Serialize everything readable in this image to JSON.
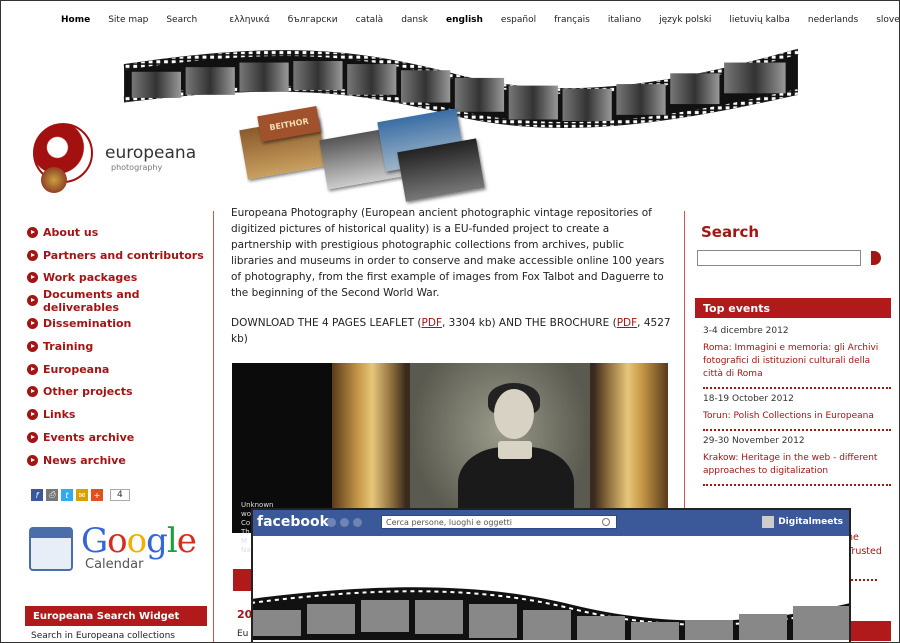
{
  "top_nav": {
    "items": [
      "Home",
      "Site map",
      "Search"
    ],
    "languages": [
      "ελληνικά",
      "български",
      "català",
      "dansk",
      "english",
      "español",
      "français",
      "italiano",
      "język polski",
      "lietuvių kalba",
      "nederlands",
      "slovenčina"
    ],
    "active_language": "english"
  },
  "logo": {
    "name": "europeana",
    "sub": "photography"
  },
  "banner_sign": "BEITHOR",
  "left_nav": [
    "About us",
    "Partners and contributors",
    "Work packages",
    "Documents and deliverables",
    "Dissemination",
    "Training",
    "Europeana",
    "Other projects",
    "Links",
    "Events archive",
    "News archive"
  ],
  "share": {
    "count": "4"
  },
  "google_calendar": {
    "google": "Google",
    "calendar": "Calendar"
  },
  "widget": {
    "title": "Europeana Search Widget",
    "sub": "Search in Europeana collections"
  },
  "main": {
    "intro": "Europeana Photography (European ancient photographic vintage repositories of digitized pictures of historical quality) is a EU-funded project to create a partnership with prestigious photographic collections from archives, public libraries and museums in order to conserve and make accessible online 100 years of photography, from the first example of images from Fox Talbot and Daguerre to the beginning of the Second World War.",
    "download_prefix": "DOWNLOAD THE 4 PAGES LEAFLET (",
    "pdf1": "PDF",
    "download_mid": ", 3304 kb) AND THE BROCHURE (",
    "pdf2": "PDF",
    "download_suffix": ", 4527 kb)",
    "portrait_caption": "Unknown woman",
    "caption_lines": [
      "Co",
      "Th",
      "M",
      "Na"
    ],
    "partial_year": "20",
    "partial_text": "Eu"
  },
  "sidebar": {
    "search_title": "Search",
    "top_events_title": "Top events",
    "events": [
      {
        "date": "3-4 dicembre 2012",
        "title": "Roma: Immagini e memoria: gli Archivi fotografici di istituzioni culturali della città di Roma"
      },
      {
        "date": "18-19 October 2012",
        "title": "Torun: Polish Collections in Europeana"
      },
      {
        "date": "29-30 November 2012",
        "title": "Krakow: Heritage in the web - different approaches to digitalization"
      }
    ],
    "partial_lines": [
      "he",
      "Trusted"
    ]
  },
  "facebook": {
    "logo": "facebook",
    "search_placeholder": "Cerca persone, luoghi e oggetti",
    "user": "Digitalmeets"
  },
  "colors": {
    "accent": "#a31515",
    "facebook": "#3b5998"
  }
}
